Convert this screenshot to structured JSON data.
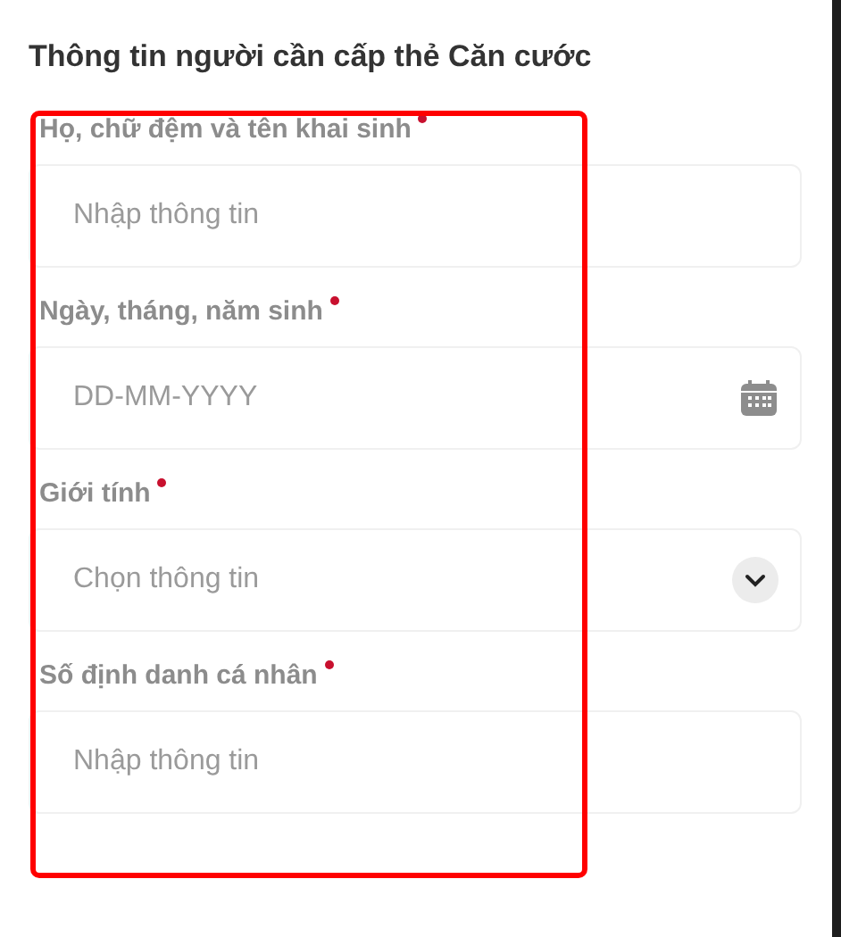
{
  "section_title": "Thông tin người cần cấp thẻ Căn cước",
  "fields": [
    {
      "kind": "text",
      "label": "Họ, chữ đệm và tên khai sinh",
      "required": true,
      "placeholder": "Nhập thông tin"
    },
    {
      "kind": "date",
      "label": "Ngày, tháng, năm sinh",
      "required": true,
      "placeholder": "DD-MM-YYYY"
    },
    {
      "kind": "select",
      "label": "Giới tính",
      "required": true,
      "placeholder": "Chọn thông tin"
    },
    {
      "kind": "text",
      "label": "Số định danh cá nhân",
      "required": true,
      "placeholder": "Nhập thông tin"
    }
  ]
}
